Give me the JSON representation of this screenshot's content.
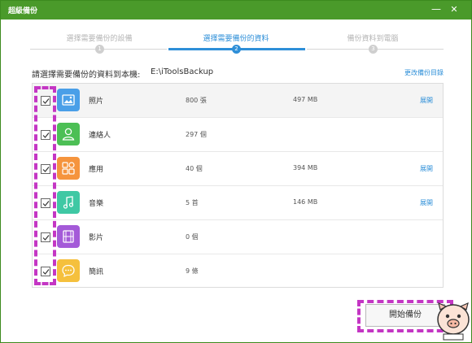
{
  "window": {
    "title": "超級備份",
    "min_glyph": "—",
    "close_glyph": "✕"
  },
  "steps": [
    {
      "label": "選擇需要備份的設備",
      "num": "1",
      "active": false
    },
    {
      "label": "選擇需要備份的資料",
      "num": "2",
      "active": true
    },
    {
      "label": "備份資料到電腦",
      "num": "3",
      "active": false
    }
  ],
  "prompt": {
    "label": "請選擇需要備份的資料到本機:",
    "path": "E:\\iToolsBackup",
    "change_link": "更改備份目錄"
  },
  "items": [
    {
      "name": "照片",
      "count": "800 張",
      "size": "497 MB",
      "expand": "展開",
      "icon": "photo-icon",
      "color": "#4a9fe8",
      "checked": true
    },
    {
      "name": "連絡人",
      "count": "297 個",
      "size": "",
      "expand": "",
      "icon": "contact-icon",
      "color": "#4cbf55",
      "checked": true
    },
    {
      "name": "應用",
      "count": "40 個",
      "size": "394 MB",
      "expand": "展開",
      "icon": "apps-icon",
      "color": "#f5943d",
      "checked": true
    },
    {
      "name": "音樂",
      "count": "5 首",
      "size": "146 MB",
      "expand": "展開",
      "icon": "music-icon",
      "color": "#3fc8a4",
      "checked": true
    },
    {
      "name": "影片",
      "count": "0 個",
      "size": "",
      "expand": "",
      "icon": "video-icon",
      "color": "#a45ad8",
      "checked": true
    },
    {
      "name": "簡訊",
      "count": "9 條",
      "size": "",
      "expand": "",
      "icon": "message-icon",
      "color": "#f5c03d",
      "checked": true
    }
  ],
  "actions": {
    "start_label": "開始備份"
  },
  "colors": {
    "titlebar": "#4a9a2a",
    "accent": "#2e8fd8",
    "highlight": "#c436c4"
  }
}
